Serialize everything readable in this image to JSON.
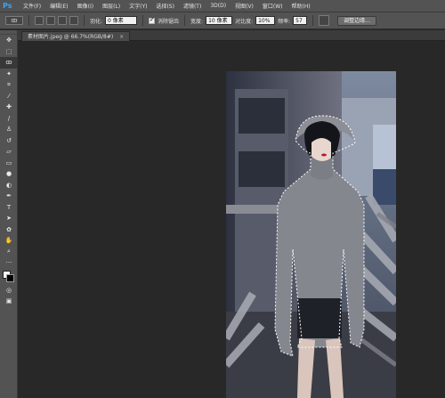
{
  "app": {
    "logo": "Ps"
  },
  "menu": [
    "文件(F)",
    "编辑(E)",
    "图像(I)",
    "图层(L)",
    "文字(Y)",
    "选择(S)",
    "滤镜(T)",
    "3D(D)",
    "视图(V)",
    "窗口(W)",
    "帮助(H)"
  ],
  "options": {
    "feather_label": "羽化:",
    "feather_value": "0 像素",
    "antialias_label": "消除锯齿",
    "width_label": "宽度:",
    "width_value": "10 像素",
    "contrast_label": "对比度:",
    "contrast_value": "10%",
    "frequency_label": "频率:",
    "frequency_value": "57",
    "refine_edge": "调整边缘..."
  },
  "document": {
    "tab_title": "素材图片.jpeg @ 66.7%(RGB/8#)",
    "close": "×"
  },
  "tools": [
    "move-icon",
    "marquee-icon",
    "magnetic-lasso-icon",
    "magic-wand-icon",
    "crop-icon",
    "eyedropper-icon",
    "healing-brush-icon",
    "brush-icon",
    "clone-stamp-icon",
    "history-brush-icon",
    "eraser-icon",
    "gradient-icon",
    "blur-icon",
    "dodge-icon",
    "pen-icon",
    "type-icon",
    "path-selection-icon",
    "shape-icon",
    "hand-icon",
    "zoom-icon"
  ],
  "colors": {
    "foreground": "#ffffff",
    "background": "#000000",
    "accent": "#31a8ff"
  }
}
